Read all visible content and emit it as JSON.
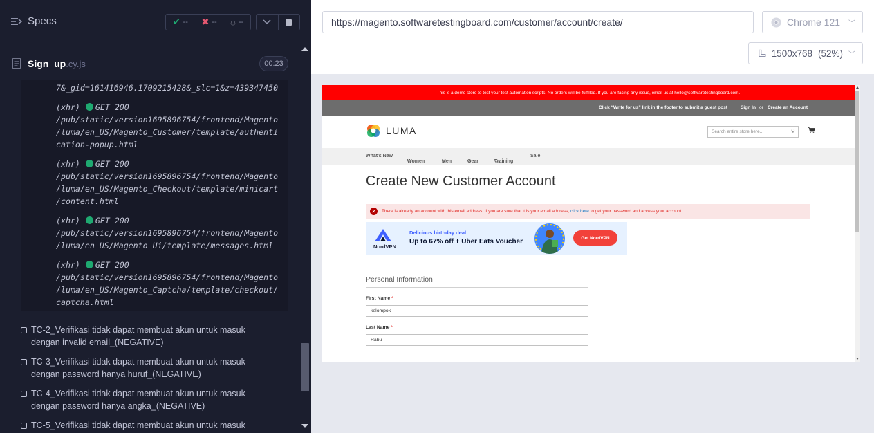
{
  "specs": {
    "title": "Specs",
    "passed": "--",
    "failed": "--",
    "pending": "--"
  },
  "spec_file": {
    "name": "Sign_up",
    "ext": ".cy.js",
    "duration": "00:23"
  },
  "log": {
    "top_line": "7&_gid=161416946.1709215428&_slc=1&z=439347450",
    "entries": [
      {
        "type": "(xhr)",
        "method": "GET 200",
        "lines": [
          "/pub/static/version1695896754/frontend/Magento",
          "/luma/en_US/Magento_Customer/template/authenti",
          "cation-popup.html"
        ]
      },
      {
        "type": "(xhr)",
        "method": "GET 200",
        "lines": [
          "/pub/static/version1695896754/frontend/Magento",
          "/luma/en_US/Magento_Checkout/template/minicart",
          "/content.html"
        ]
      },
      {
        "type": "(xhr)",
        "method": "GET 200",
        "lines": [
          "/pub/static/version1695896754/frontend/Magento",
          "/luma/en_US/Magento_Ui/template/messages.html"
        ]
      },
      {
        "type": "(xhr)",
        "method": "GET 200",
        "lines": [
          "/pub/static/version1695896754/frontend/Magento",
          "/luma/en_US/Magento_Captcha/template/checkout/",
          "captcha.html"
        ]
      }
    ]
  },
  "tests": [
    {
      "line1": "TC-2_Verifikasi tidak dapat membuat akun untuk masuk",
      "line2": "dengan invalid email_(NEGATIVE)"
    },
    {
      "line1": "TC-3_Verifikasi tidak dapat membuat akun untuk masuk",
      "line2": "dengan password hanya huruf_(NEGATIVE)"
    },
    {
      "line1": "TC-4_Verifikasi tidak dapat membuat akun untuk masuk",
      "line2": "dengan password hanya angka_(NEGATIVE)"
    },
    {
      "line1": "TC-5_Verifikasi tidak dapat membuat akun untuk masuk",
      "line2": ""
    }
  ],
  "browser": {
    "url": "https://magento.softwaretestingboard.com/customer/account/create/",
    "name": "Chrome 121",
    "viewport": "1500x768",
    "scale": "(52%)"
  },
  "site": {
    "notice": "This is a demo store to test your test automation scripts. No orders will be fulfilled. If you are facing any issue, email us at hello@softwaretestingboard.com.",
    "guest_post": "Click “Write for us” link in the footer to submit a guest post",
    "sign_in": "Sign In",
    "or": "or",
    "create_account": "Create an Account",
    "logo": "LUMA",
    "search_placeholder": "Search entire store here...",
    "nav": [
      "What's New",
      "Women",
      "Men",
      "Gear",
      "Training",
      "Sale"
    ],
    "page_title": "Create New Customer Account",
    "error_msg": "There is already an account with this email address. If you are sure that it is your email address,",
    "error_link": "click here",
    "error_tail": "to get your password and access your account.",
    "ad": {
      "brand": "NordVPN",
      "tag": "Delicious birthday deal",
      "headline": "Up to 67% off + Uber Eats Voucher",
      "cta": "Get NordVPN"
    },
    "legend": "Personal Information",
    "first_name_label": "First Name",
    "first_name_value": "kelompok",
    "last_name_label": "Last Name",
    "last_name_value": "Rabu",
    "required_mark": "*"
  },
  "colors": {
    "reporter_bg": "#1b1e2e",
    "pass": "#1fa971",
    "fail": "#e45770",
    "notice_red": "#ff0000",
    "error_bg": "#fae5e5",
    "nord_cta": "#f2413a"
  }
}
